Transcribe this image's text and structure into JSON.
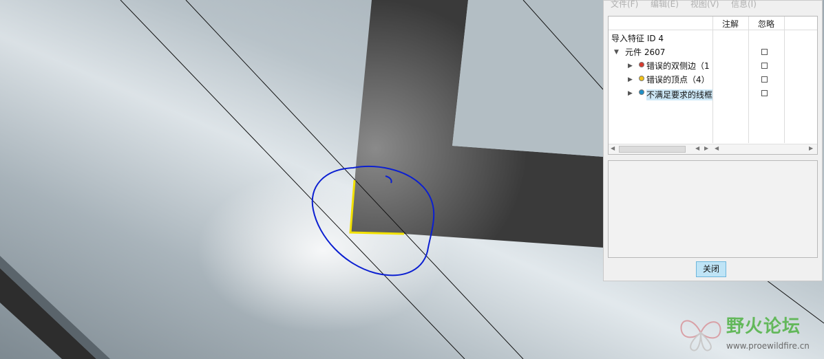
{
  "menu": {
    "file": "文件(F)",
    "edit": "编辑(E)",
    "view": "视图(V)",
    "info": "信息(I)"
  },
  "table": {
    "col_annotation": "注解",
    "col_ignore": "忽略"
  },
  "tree": {
    "root": "导入特征 ID 4",
    "part": "元件 2607",
    "items": [
      {
        "label": "错误的双侧边（1",
        "dot_color": "#d83a2e"
      },
      {
        "label": "错误的顶点（4）",
        "dot_color": "#f2c318"
      },
      {
        "label": "不满足要求的线框",
        "dot_color": "#1d8fc7"
      }
    ]
  },
  "buttons": {
    "close": "关闭"
  },
  "watermark": {
    "title": "野火论坛",
    "url": "www.proewildfire.cn"
  },
  "colors": {
    "selection": "#cde8f7",
    "highlight_edge": "#f2e100",
    "markup_stroke": "#0b1fd1",
    "brand_green": "#63b85b"
  }
}
